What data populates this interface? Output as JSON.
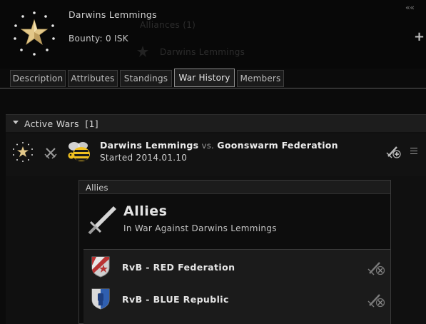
{
  "header": {
    "corp_name": "Darwins Lemmings",
    "bounty": "Bounty: 0 ISK",
    "ghost_alliances": "Alliances (1)",
    "ghost_member": "Darwins Lemmings"
  },
  "tabs": [
    {
      "label": "Description"
    },
    {
      "label": "Attributes"
    },
    {
      "label": "Standings"
    },
    {
      "label": "War History"
    },
    {
      "label": "Members"
    }
  ],
  "active_tab": "War History",
  "active_wars": {
    "title": "Active Wars",
    "count": "[1]"
  },
  "war": {
    "aggressor": "Darwins Lemmings",
    "vs": "vs.",
    "defender": "Goonswarm Federation",
    "started": "Started 2014.01.10"
  },
  "allies_panel": {
    "header": "Allies",
    "title": "Allies",
    "subtitle": "In War Against Darwins Lemmings",
    "items": [
      {
        "name": "RvB - RED Federation"
      },
      {
        "name": "RvB - BLUE Republic"
      }
    ]
  },
  "colors": {
    "background": "#0b0b0b",
    "panel": "#1b1b1b",
    "text": "#d8d8d8",
    "red_federation": "#b83232",
    "blue_republic": "#2f5fb0"
  },
  "icons": {
    "corp_logo": "star-circle-logo",
    "war_swords": "crossed-swords-icon",
    "defender_logo": "bee-logo",
    "ally_swords": "sword-icon",
    "add_ally": "sword-plus-icon",
    "menu": "hamburger-icon"
  }
}
